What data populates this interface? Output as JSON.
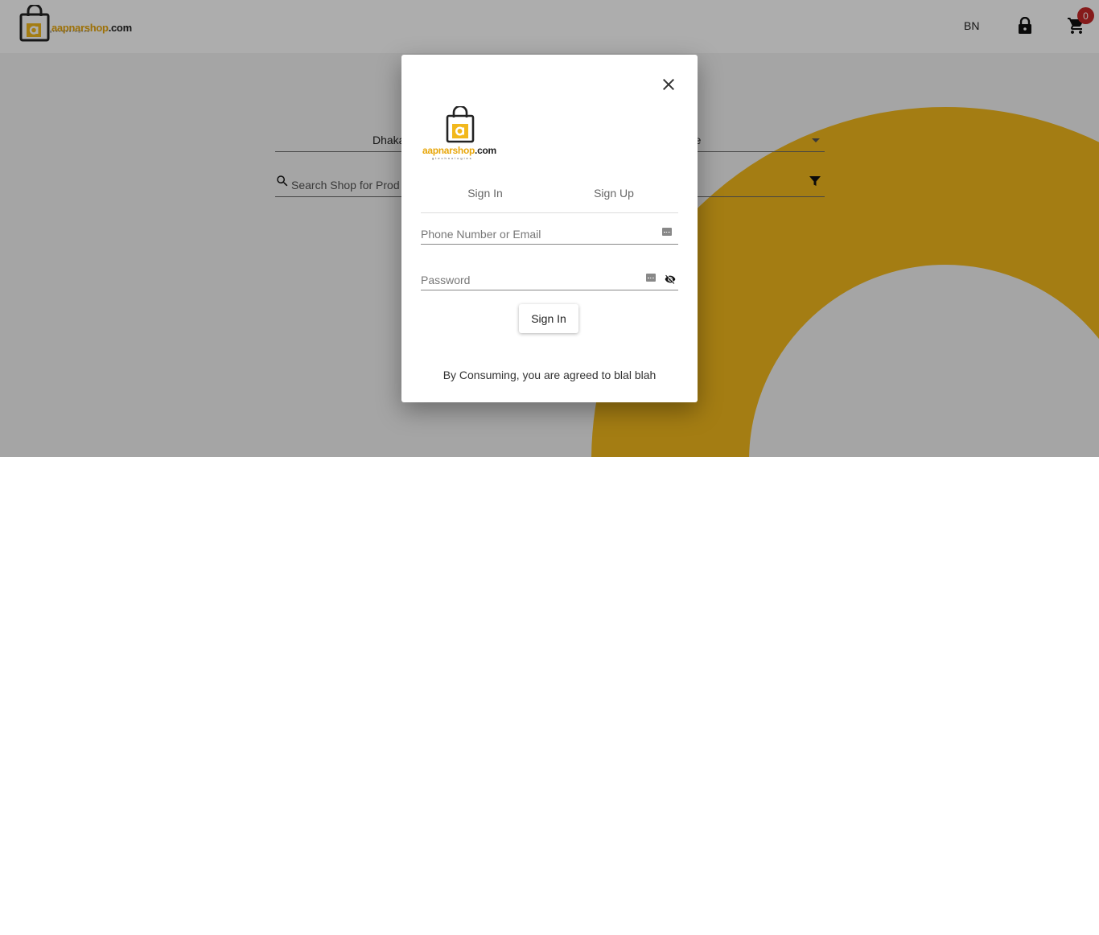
{
  "brand": {
    "name_yellow": "aapnarshop",
    "name_dark": ".com",
    "tagline": "gtechnologies",
    "accent": "#f2b81c"
  },
  "header": {
    "language": "BN",
    "cart_count": "0"
  },
  "location": {
    "left_value": "Dhaka",
    "right_value": "ane"
  },
  "search": {
    "placeholder": "Search Shop for Prod"
  },
  "modal": {
    "tabs": [
      {
        "label": "Sign In"
      },
      {
        "label": "Sign Up"
      }
    ],
    "fields": {
      "identity_placeholder": "Phone Number or Email",
      "password_placeholder": "Password"
    },
    "submit_label": "Sign In",
    "terms": "By Consuming, you are agreed to blal blah"
  },
  "icons": {
    "close": "close-icon",
    "lock": "lock-icon",
    "cart": "cart-icon",
    "search": "search-icon",
    "filter": "filter-icon",
    "visibility_off": "visibility-off-icon"
  }
}
